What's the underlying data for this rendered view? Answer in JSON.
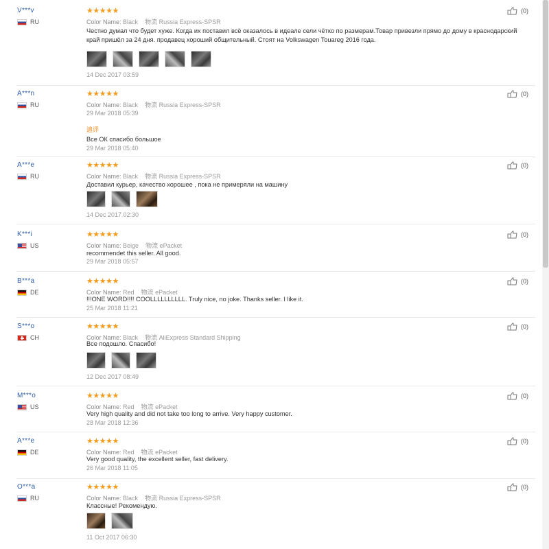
{
  "reviews": [
    {
      "user": "V***v",
      "country": "RU",
      "flag": "ru",
      "stars": "★★★★★",
      "color_key": "Color Name:",
      "color": "Black",
      "ship_key": "物流",
      "shipping": "Russia Express-SPSR",
      "text": "Честно думал что будет хуже. Когда их поставил всё оказалось в идеале сели чётко по размерам.Товар привезли прямо до дому в краснодарский край пришёл за 24 дня. продавец хороший общительный. Стоят на Volkswagen Touareg 2016 года.",
      "photos": 5,
      "date": "14 Dec 2017 03:59",
      "likes": "(0)"
    },
    {
      "user": "A***n",
      "country": "RU",
      "flag": "ru",
      "stars": "★★★★★",
      "color_key": "Color Name:",
      "color": "Black",
      "ship_key": "物流",
      "shipping": "Russia Express-SPSR",
      "date": "29 Mar 2018 05:39",
      "additional_label": "追评",
      "additional_text": "Все ОК спасибо большое",
      "additional_date": "29 Mar 2018 05:40",
      "likes": "(0)"
    },
    {
      "user": "A***e",
      "country": "RU",
      "flag": "ru",
      "stars": "★★★★★",
      "color_key": "Color Name:",
      "color": "Black",
      "ship_key": "物流",
      "shipping": "Russia Express-SPSR",
      "text": "Доставил курьер, качество хорошее , пока не примеряли на машину",
      "photos": 3,
      "date": "14 Dec 2017 02:30",
      "likes": "(0)"
    },
    {
      "user": "K***i",
      "country": "US",
      "flag": "us",
      "stars": "★★★★★",
      "color_key": "Color Name:",
      "color": "Beige",
      "ship_key": "物流",
      "shipping": "ePacket",
      "text": "recommendet this seller. All good.",
      "date": "29 Mar 2018 05:57",
      "likes": "(0)"
    },
    {
      "user": "B***a",
      "country": "DE",
      "flag": "de",
      "stars": "★★★★★",
      "color_key": "Color Name:",
      "color": "Red",
      "ship_key": "物流",
      "shipping": "ePacket",
      "text": "!!!ONE WORD!!!! COOLLLLLLLLLL. Truly nice, no joke. Thanks seller. I like it.",
      "date": "25 Mar 2018 11:21",
      "likes": "(0)"
    },
    {
      "user": "S***o",
      "country": "CH",
      "flag": "ch",
      "stars": "★★★★★",
      "color_key": "Color Name:",
      "color": "Black",
      "ship_key": "物流",
      "shipping": "AliExpress Standard Shipping",
      "text": "Все подошло. Спасибо!",
      "photos": 3,
      "date": "12 Dec 2017 08:49",
      "likes": "(0)"
    },
    {
      "user": "M***o",
      "country": "US",
      "flag": "us",
      "stars": "★★★★★",
      "color_key": "Color Name:",
      "color": "Red",
      "ship_key": "物流",
      "shipping": "ePacket",
      "text": "Very high quality and did not take too long to arrive. Very happy customer.",
      "date": "28 Mar 2018 12:36",
      "likes": "(0)"
    },
    {
      "user": "A***e",
      "country": "DE",
      "flag": "de",
      "stars": "★★★★★",
      "color_key": "Color Name:",
      "color": "Red",
      "ship_key": "物流",
      "shipping": "ePacket",
      "text": "Very good quality, the excellent seller, fast delivery.",
      "date": "26 Mar 2018 11:05",
      "likes": "(0)"
    },
    {
      "user": "O***a",
      "country": "RU",
      "flag": "ru",
      "stars": "★★★★★",
      "color_key": "Color Name:",
      "color": "Black",
      "ship_key": "物流",
      "shipping": "Russia Express-SPSR",
      "text": "Классные! Рекомендую.",
      "photos": 2,
      "date": "11 Oct 2017 06:30",
      "likes": "(0)"
    }
  ]
}
